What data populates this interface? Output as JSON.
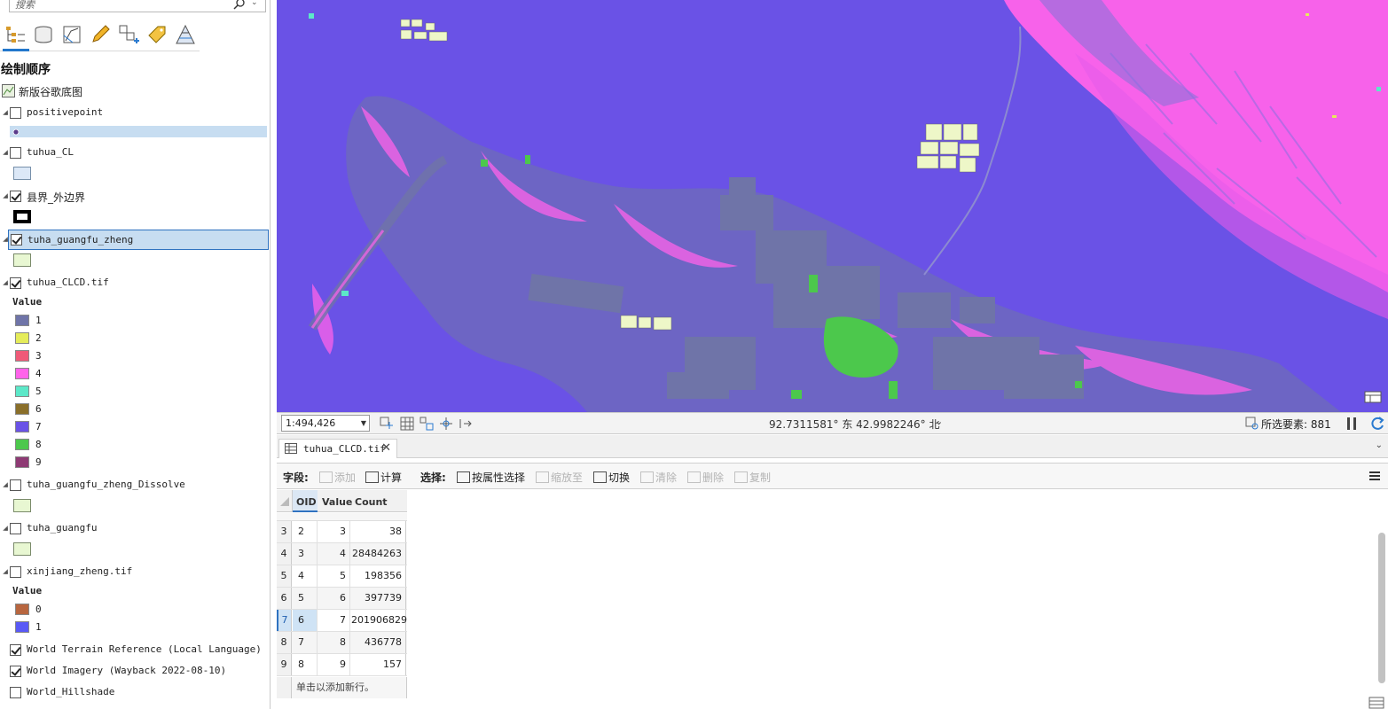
{
  "search": {
    "placeholder": "搜索"
  },
  "contents": {
    "title": "绘制顺序",
    "basemap_group": "新版谷歌底图",
    "layers": [
      {
        "name": "positivepoint",
        "checked": false
      },
      {
        "name": "tuhua_CL",
        "checked": false
      },
      {
        "name": "县界_外边界",
        "checked": true
      },
      {
        "name": "tuha_guangfu_zheng",
        "checked": true,
        "selected": true
      },
      {
        "name": "tuhua_CLCD.tif",
        "checked": true
      },
      {
        "name": "tuha_guangfu_zheng_Dissolve",
        "checked": false
      },
      {
        "name": "tuha_guangfu",
        "checked": false
      },
      {
        "name": "xinjiang_zheng.tif",
        "checked": false
      },
      {
        "name": "World Terrain Reference (Local Language)",
        "checked": true
      },
      {
        "name": "World Imagery (Wayback 2022-08-10)",
        "checked": true
      },
      {
        "name": "World_Hillshade",
        "checked": false
      }
    ],
    "value_header": "Value",
    "clcd_legend": [
      {
        "label": "1",
        "color": "#6f74a8"
      },
      {
        "label": "2",
        "color": "#e5ec5a"
      },
      {
        "label": "3",
        "color": "#ef5a78"
      },
      {
        "label": "4",
        "color": "#ff63ea"
      },
      {
        "label": "5",
        "color": "#5ce8c8"
      },
      {
        "label": "6",
        "color": "#8a6f2a"
      },
      {
        "label": "7",
        "color": "#6a52e6"
      },
      {
        "label": "8",
        "color": "#4cc84c"
      },
      {
        "label": "9",
        "color": "#8e3a74"
      }
    ],
    "xinjiang_legend": [
      {
        "label": "0",
        "color": "#b8663f"
      },
      {
        "label": "1",
        "color": "#5959f5"
      }
    ]
  },
  "status": {
    "scale": "1:494,426",
    "coords": "92.7311581° 东  42.9982246° 北",
    "selected_features": "所选要素: 881"
  },
  "attribute_table": {
    "tab_title": "tuhua_CLCD.tif",
    "toolbar": {
      "field_label": "字段:",
      "add": "添加",
      "calculate": "计算",
      "select_label": "选择:",
      "select_by_attr": "按属性选择",
      "zoom_to": "缩放至",
      "switch": "切换",
      "clear": "清除",
      "delete": "删除",
      "copy": "复制"
    },
    "columns": [
      "OID",
      "Value",
      "Count"
    ],
    "rows": [
      {
        "rn": "3",
        "oid": "2",
        "value": "3",
        "count": "38"
      },
      {
        "rn": "4",
        "oid": "3",
        "value": "4",
        "count": "28484263"
      },
      {
        "rn": "5",
        "oid": "4",
        "value": "5",
        "count": "198356"
      },
      {
        "rn": "6",
        "oid": "5",
        "value": "6",
        "count": "397739"
      },
      {
        "rn": "7",
        "oid": "6",
        "value": "7",
        "count": "201906829",
        "current": true
      },
      {
        "rn": "8",
        "oid": "7",
        "value": "8",
        "count": "436778"
      },
      {
        "rn": "9",
        "oid": "8",
        "value": "9",
        "count": "157"
      }
    ],
    "add_row_hint": "单击以添加新行。"
  },
  "colors": {
    "map_background": "#6a52e6",
    "urban": "#6f74a8",
    "pink": "#ff63ea",
    "green": "#4cc84c",
    "selection": "#c7ddf1",
    "accent": "#2277cc"
  },
  "icons": {
    "toolbar": [
      "list-by-drawing-order-icon",
      "list-by-source-icon",
      "list-by-selection-icon",
      "list-by-editing-icon",
      "list-by-snapping-icon",
      "list-by-labeling-icon",
      "list-by-perspective-icon"
    ]
  }
}
